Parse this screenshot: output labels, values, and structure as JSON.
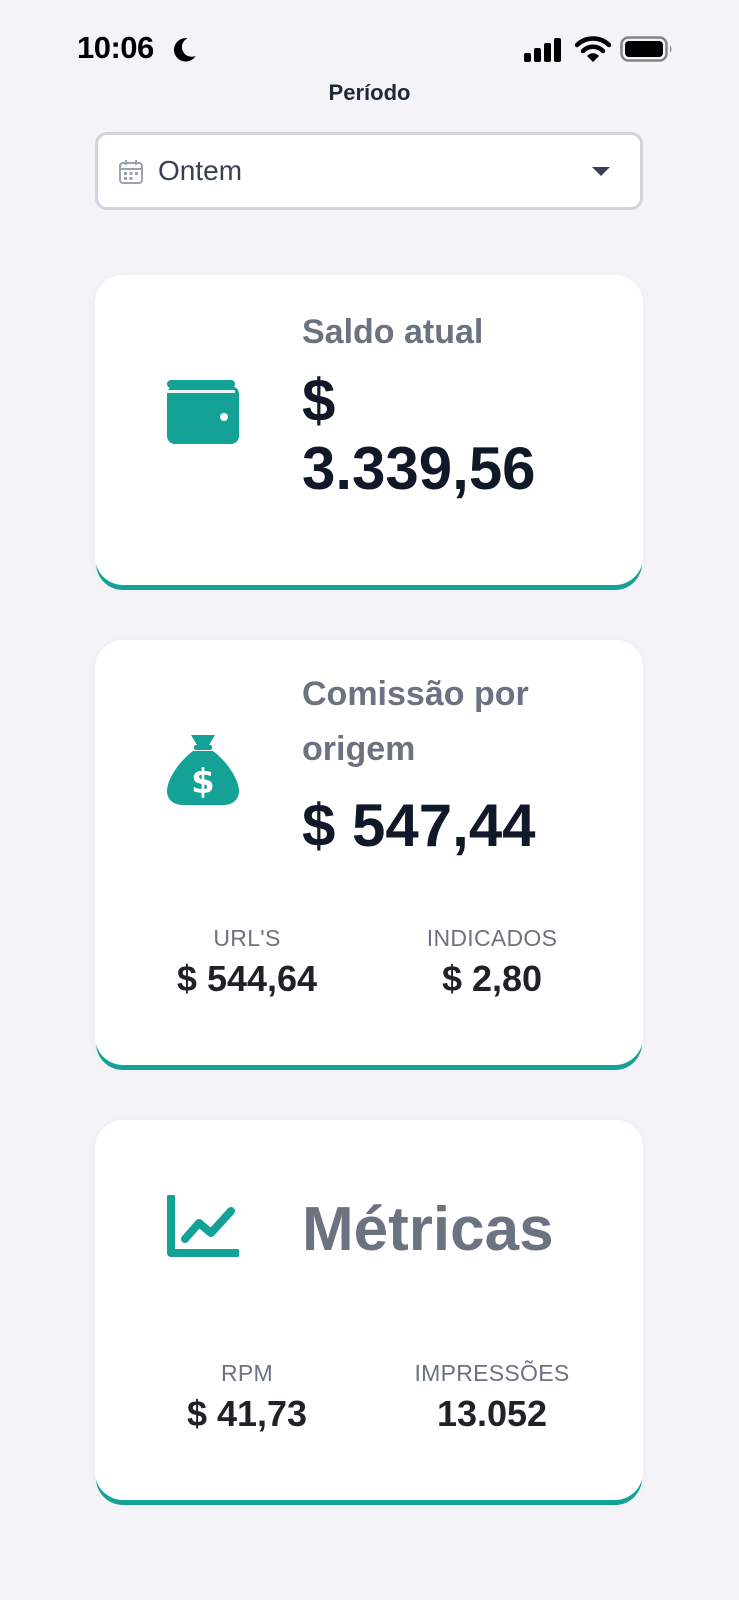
{
  "status_bar": {
    "time": "10:06"
  },
  "period": {
    "label": "Período",
    "selected": "Ontem"
  },
  "balance": {
    "title": "Saldo atual",
    "value_line1": "$",
    "value_line2": "3.339,56"
  },
  "commission": {
    "title_line1": "Comissão por",
    "title_line2": "origem",
    "value": "$ 547,44",
    "urls_label": "URL'S",
    "urls_value": "$ 544,64",
    "referred_label": "INDICADOS",
    "referred_value": "$ 2,80"
  },
  "metrics": {
    "title": "Métricas",
    "rpm_label": "RPM",
    "rpm_value": "$ 41,73",
    "impressions_label": "IMPRESSÕES",
    "impressions_value": "13.052"
  },
  "colors": {
    "accent": "#14a196",
    "muted": "#6b7280",
    "dark": "#111827"
  }
}
